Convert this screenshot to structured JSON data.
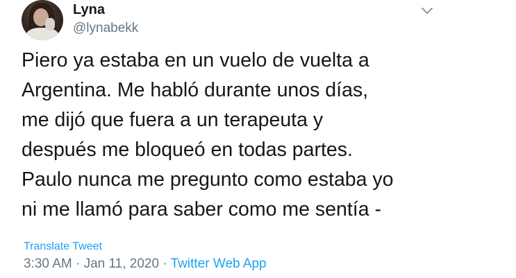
{
  "user": {
    "display_name": "Lyna",
    "handle": "@lynabekk"
  },
  "tweet": {
    "lines": [
      "Piero ya estaba en un vuelo de vuelta a",
      "Argentina. Me habló durante unos días,",
      "me dijó que fuera a un terapeuta y",
      "después me bloqueó en todas partes.",
      "Paulo nunca me pregunto como estaba yo",
      "ni me llamó para saber como me sentía -"
    ],
    "translate_label": "Translate Tweet",
    "time": "3:30 AM",
    "separator": " · ",
    "date": "Jan 11, 2020",
    "source": "Twitter Web App"
  },
  "icons": {
    "menu": "chevron-down-icon"
  },
  "colors": {
    "link": "#1da1f2",
    "secondary_text": "#657786",
    "primary_text": "#14171a"
  }
}
